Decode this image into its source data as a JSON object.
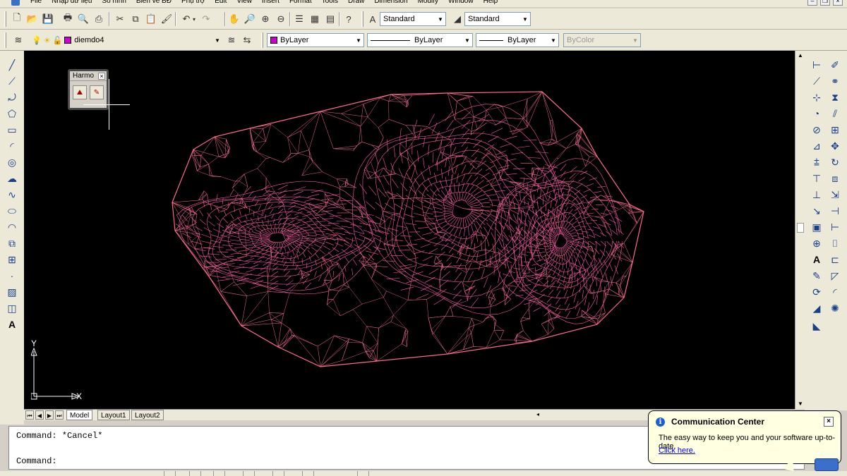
{
  "menu": {
    "items": [
      "File",
      "Nhập dữ liệu",
      "Số hình",
      "Biên vẽ BĐ",
      "Phụ trợ",
      "Edit",
      "View",
      "Insert",
      "Format",
      "Tools",
      "Draw",
      "Dimension",
      "Modify",
      "Window",
      "Help"
    ]
  },
  "toolbar1": {
    "text_style": "Standard",
    "dim_style": "Standard"
  },
  "toolbar2": {
    "layer": "diemdo4",
    "layer_color": "#cc00cc",
    "color": "ByLayer",
    "linetype": "ByLayer",
    "lineweight": "ByLayer",
    "plotstyle": "ByColor"
  },
  "floating_toolbar": {
    "title": "Harmo"
  },
  "ucs": {
    "x_label": "X",
    "y_label": "Y"
  },
  "tabs": [
    "Model",
    "Layout1",
    "Layout2"
  ],
  "active_tab": "Model",
  "command": {
    "history": "Command: *Cancel*",
    "prompt": "Command:"
  },
  "communication_center": {
    "title": "Communication Center",
    "message": "The easy way to keep you and your software up-to-date.",
    "link": "Click here."
  },
  "colors": {
    "mesh": "#ff5ca8",
    "mesh_secondary": "#e0608c",
    "viewport_bg": "#000000",
    "toolbar_bg": "#ece9d8"
  }
}
